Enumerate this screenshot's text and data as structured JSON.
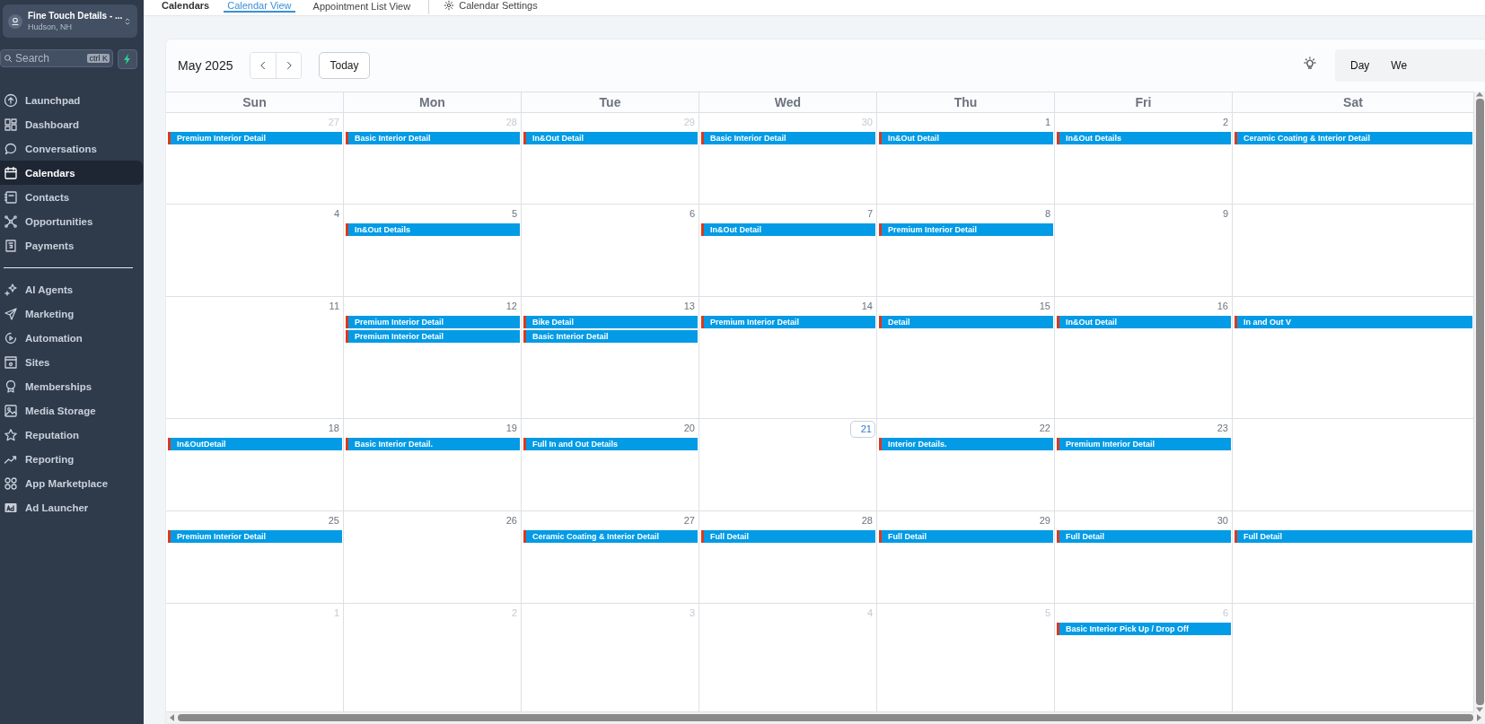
{
  "sidebar": {
    "account": {
      "name": "Fine Touch Details - ...",
      "location": "Hudson, NH"
    },
    "search": {
      "placeholder": "Search",
      "shortcut": "ctrl K"
    },
    "items": [
      {
        "label": "Launchpad",
        "selected": false
      },
      {
        "label": "Dashboard",
        "selected": false
      },
      {
        "label": "Conversations",
        "selected": false
      },
      {
        "label": "Calendars",
        "selected": true
      },
      {
        "label": "Contacts",
        "selected": false
      },
      {
        "label": "Opportunities",
        "selected": false
      },
      {
        "label": "Payments",
        "selected": false
      }
    ],
    "items_2": [
      {
        "label": "AI Agents",
        "selected": false
      },
      {
        "label": "Marketing",
        "selected": false
      },
      {
        "label": "Automation",
        "selected": false
      },
      {
        "label": "Sites",
        "selected": false
      },
      {
        "label": "Memberships",
        "selected": false
      },
      {
        "label": "Media Storage",
        "selected": false
      },
      {
        "label": "Reputation",
        "selected": false
      },
      {
        "label": "Reporting",
        "selected": false
      },
      {
        "label": "App Marketplace",
        "selected": false
      },
      {
        "label": "Ad Launcher",
        "selected": false
      }
    ]
  },
  "header": {
    "title": "Calendars",
    "tabs": [
      {
        "label": "Calendar View",
        "selected": true
      },
      {
        "label": "Appointment List View",
        "selected": false
      }
    ],
    "settings": "Calendar Settings"
  },
  "calendar": {
    "month": "May 2025",
    "today_button": "Today",
    "views": [
      "Day",
      "We"
    ],
    "weekdays": [
      "Sun",
      "Mon",
      "Tue",
      "Wed",
      "Thu",
      "Fri",
      "Sat"
    ],
    "weeks": [
      {
        "days": [
          {
            "date": "27",
            "muted": true,
            "today": false,
            "events": [
              "Premium Interior Detail"
            ]
          },
          {
            "date": "28",
            "muted": true,
            "today": false,
            "events": [
              "Basic Interior Detail"
            ]
          },
          {
            "date": "29",
            "muted": true,
            "today": false,
            "events": [
              "In&Out Detail"
            ]
          },
          {
            "date": "30",
            "muted": true,
            "today": false,
            "events": [
              "Basic Interior Detail"
            ]
          },
          {
            "date": "1",
            "muted": false,
            "today": false,
            "events": [
              "In&Out Detail"
            ]
          },
          {
            "date": "2",
            "muted": false,
            "today": false,
            "events": [
              "In&Out Details"
            ]
          },
          {
            "events": [
              "Ceramic Coating & Interior Detail"
            ]
          }
        ]
      },
      {
        "days": [
          {
            "date": "4",
            "muted": false,
            "today": false
          },
          {
            "date": "5",
            "muted": false,
            "today": false,
            "events": [
              "In&Out Details"
            ]
          },
          {
            "date": "6",
            "muted": false,
            "today": false
          },
          {
            "date": "7",
            "muted": false,
            "today": false,
            "events": [
              "In&Out Detail"
            ]
          },
          {
            "date": "8",
            "muted": false,
            "today": false,
            "events": [
              "Premium Interior Detail"
            ]
          },
          {
            "date": "9",
            "muted": false,
            "today": false
          }
        ]
      },
      {
        "days": [
          {
            "date": "11",
            "muted": false,
            "today": false
          },
          {
            "date": "12",
            "muted": false,
            "today": false,
            "events": [
              "Premium Interior Detail",
              "Premium Interior Detail"
            ]
          },
          {
            "date": "13",
            "muted": false,
            "today": false,
            "events": [
              "Bike Detail",
              "Basic Interior Detail"
            ]
          },
          {
            "date": "14",
            "muted": false,
            "today": false,
            "events": [
              "Premium Interior Detail"
            ]
          },
          {
            "date": "15",
            "muted": false,
            "today": false,
            "events": [
              "Detail"
            ]
          },
          {
            "date": "16",
            "muted": false,
            "today": false,
            "events": [
              "In&Out Detail"
            ]
          },
          {
            "events": [
              "In and Out V"
            ]
          }
        ]
      },
      {
        "days": [
          {
            "date": "18",
            "muted": false,
            "today": false,
            "events": [
              "In&OutDetail"
            ]
          },
          {
            "date": "19",
            "muted": false,
            "today": false,
            "events": [
              "Basic Interior Detail."
            ]
          },
          {
            "date": "20",
            "muted": false,
            "today": false,
            "events": [
              "Full In and Out Details"
            ]
          },
          {
            "date": "21",
            "muted": false,
            "today": true
          },
          {
            "date": "22",
            "muted": false,
            "today": false,
            "events": [
              "Interior Details."
            ]
          },
          {
            "date": "23",
            "muted": false,
            "today": false,
            "events": [
              "Premium Interior Detail"
            ]
          }
        ]
      },
      {
        "days": [
          {
            "date": "25",
            "muted": false,
            "today": false,
            "events": [
              "Premium Interior Detail"
            ]
          },
          {
            "date": "26",
            "muted": false,
            "today": false
          },
          {
            "date": "27",
            "muted": false,
            "today": false,
            "events": [
              "Ceramic Coating & Interior Detail"
            ]
          },
          {
            "date": "28",
            "muted": false,
            "today": false,
            "events": [
              "Full Detail"
            ]
          },
          {
            "date": "29",
            "muted": false,
            "today": false,
            "events": [
              "Full Detail"
            ]
          },
          {
            "date": "30",
            "muted": false,
            "today": false,
            "events": [
              "Full Detail"
            ]
          },
          {
            "events": [
              "Full Detail"
            ]
          }
        ]
      },
      {
        "days": [
          {
            "date": "1",
            "muted": true,
            "today": false
          },
          {
            "date": "2",
            "muted": true,
            "today": false
          },
          {
            "date": "3",
            "muted": true,
            "today": false
          },
          {
            "date": "4",
            "muted": true,
            "today": false
          },
          {
            "date": "5",
            "muted": true,
            "today": false
          },
          {
            "date": "6",
            "muted": true,
            "today": false,
            "events": [
              "Basic Interior Pick Up / Drop Off"
            ]
          }
        ]
      }
    ]
  }
}
